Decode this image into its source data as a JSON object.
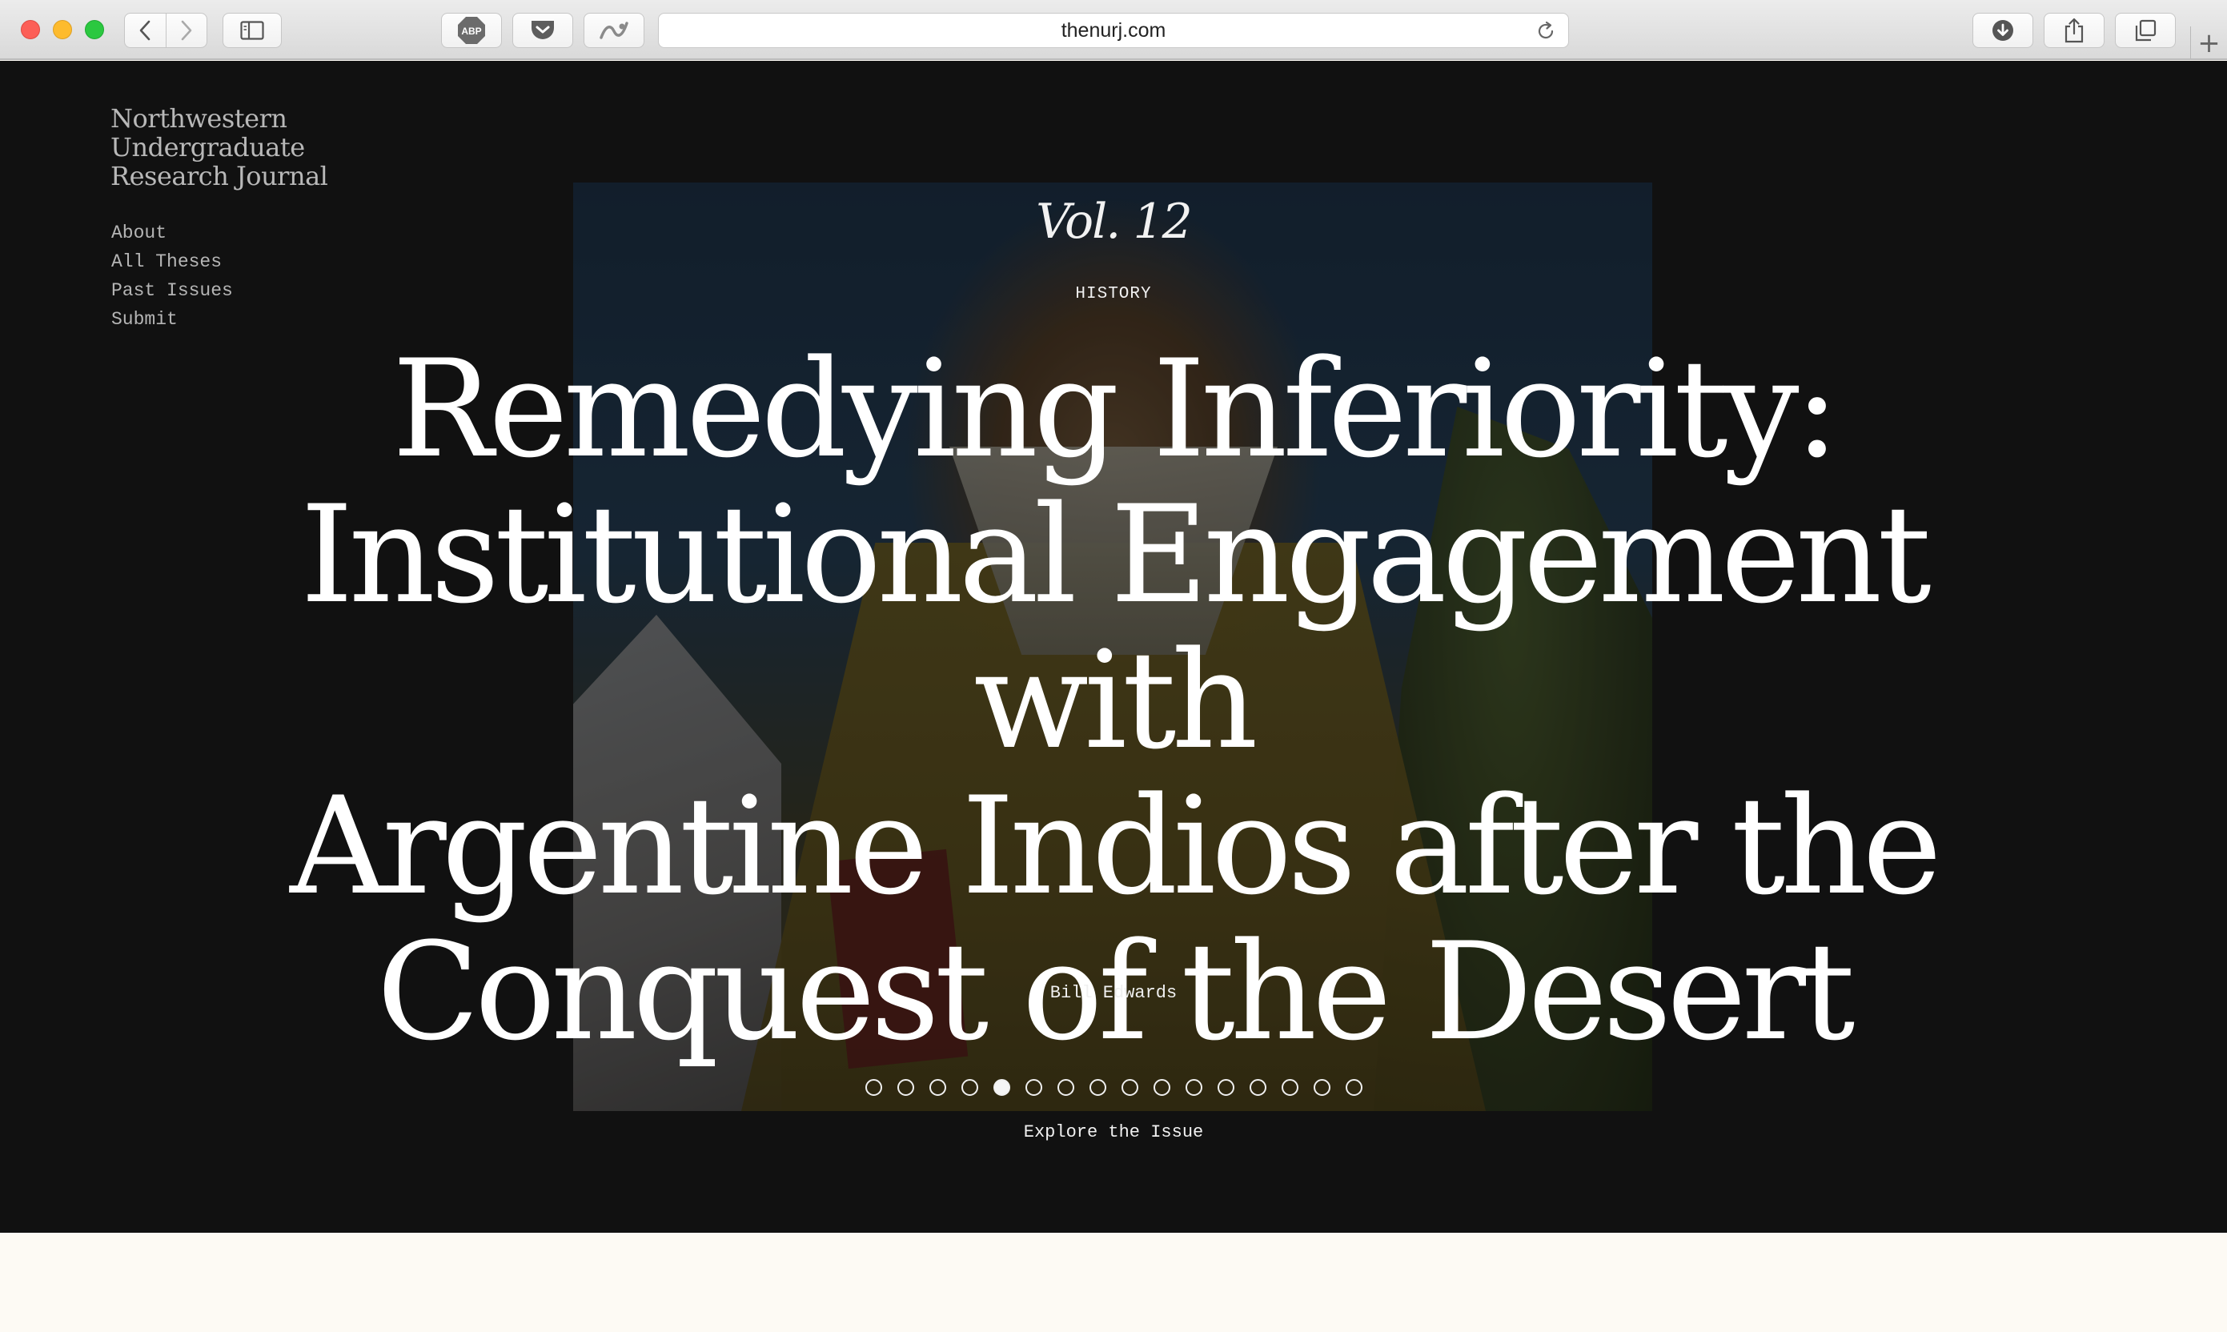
{
  "browser": {
    "url": "thenurj.com",
    "abp_label": "ABP",
    "new_tab_label": "+"
  },
  "site": {
    "brand_lines": [
      "Northwestern",
      "Undergraduate",
      "Research Journal"
    ],
    "nav": [
      "About",
      "All Theses",
      "Past Issues",
      "Submit"
    ]
  },
  "feature": {
    "volume": "Vol. 12",
    "category": "HISTORY",
    "title_lines": [
      "Remedying Inferiority:",
      "Institutional Engagement with",
      "Argentine Indios after the",
      "Conquest of the Desert"
    ],
    "author": "Bill Edwards",
    "carousel": {
      "count": 16,
      "active_index": 4
    },
    "cta": "Explore the Issue"
  }
}
